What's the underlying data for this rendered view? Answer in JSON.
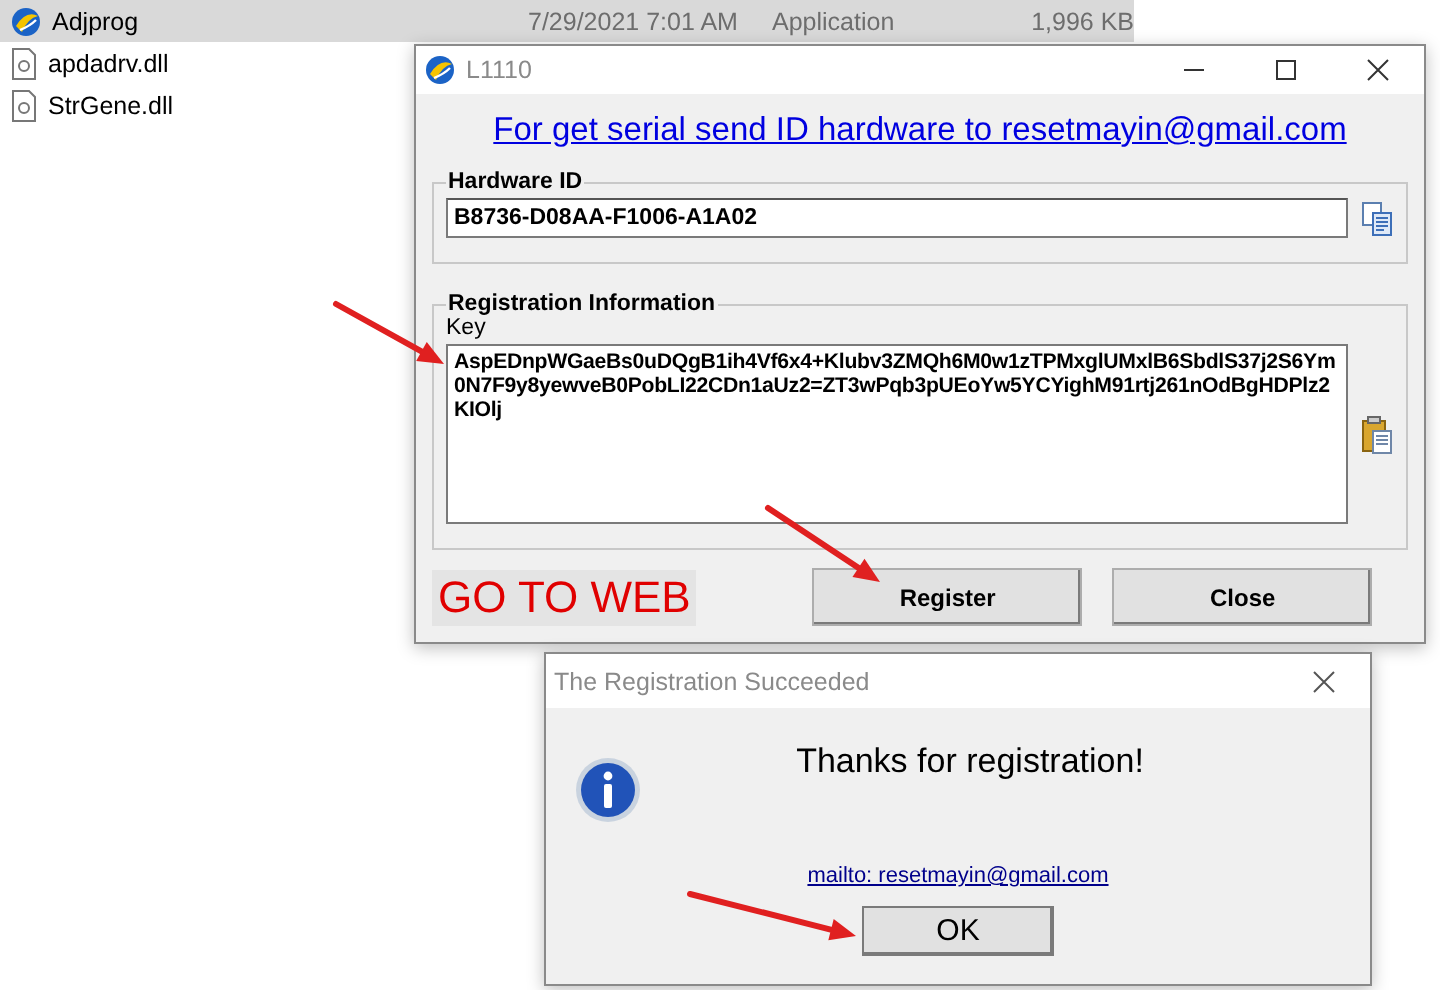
{
  "files": [
    {
      "name": "Adjprog",
      "date": "7/29/2021 7:01 AM",
      "type": "Application",
      "size": "1,996 KB",
      "kind": "app",
      "selected": true
    },
    {
      "name": "apdadrv.dll",
      "kind": "dll",
      "selected": false
    },
    {
      "name": "StrGene.dll",
      "kind": "dll",
      "selected": false
    }
  ],
  "main_window": {
    "title": "L1110",
    "link": "For get serial send ID hardware to resetmayin@gmail.com",
    "hardware_group": {
      "title": "Hardware ID",
      "value": "B8736-D08AA-F1006-A1A02"
    },
    "registration_group": {
      "title": "Registration Information",
      "key_label": "Key",
      "value": "AspEDnpWGaeBs0uDQgB1ih4Vf6x4+Klubv3ZMQh6M0w1zTPMxglUMxlB6SbdlS37j2S6Ym0N7F9y8yewveB0PobLI22CDn1aUz2=ZT3wPqb3pUEoYw5YCYighM91rtj261nOdBgHDPlz2KIOlj"
    },
    "go_to_web": "GO TO WEB",
    "buttons": [
      "Register",
      "Close"
    ]
  },
  "dialog": {
    "title": "The Registration Succeeded",
    "message": "Thanks for registration!",
    "link": "mailto: resetmayin@gmail.com",
    "button": "OK"
  }
}
